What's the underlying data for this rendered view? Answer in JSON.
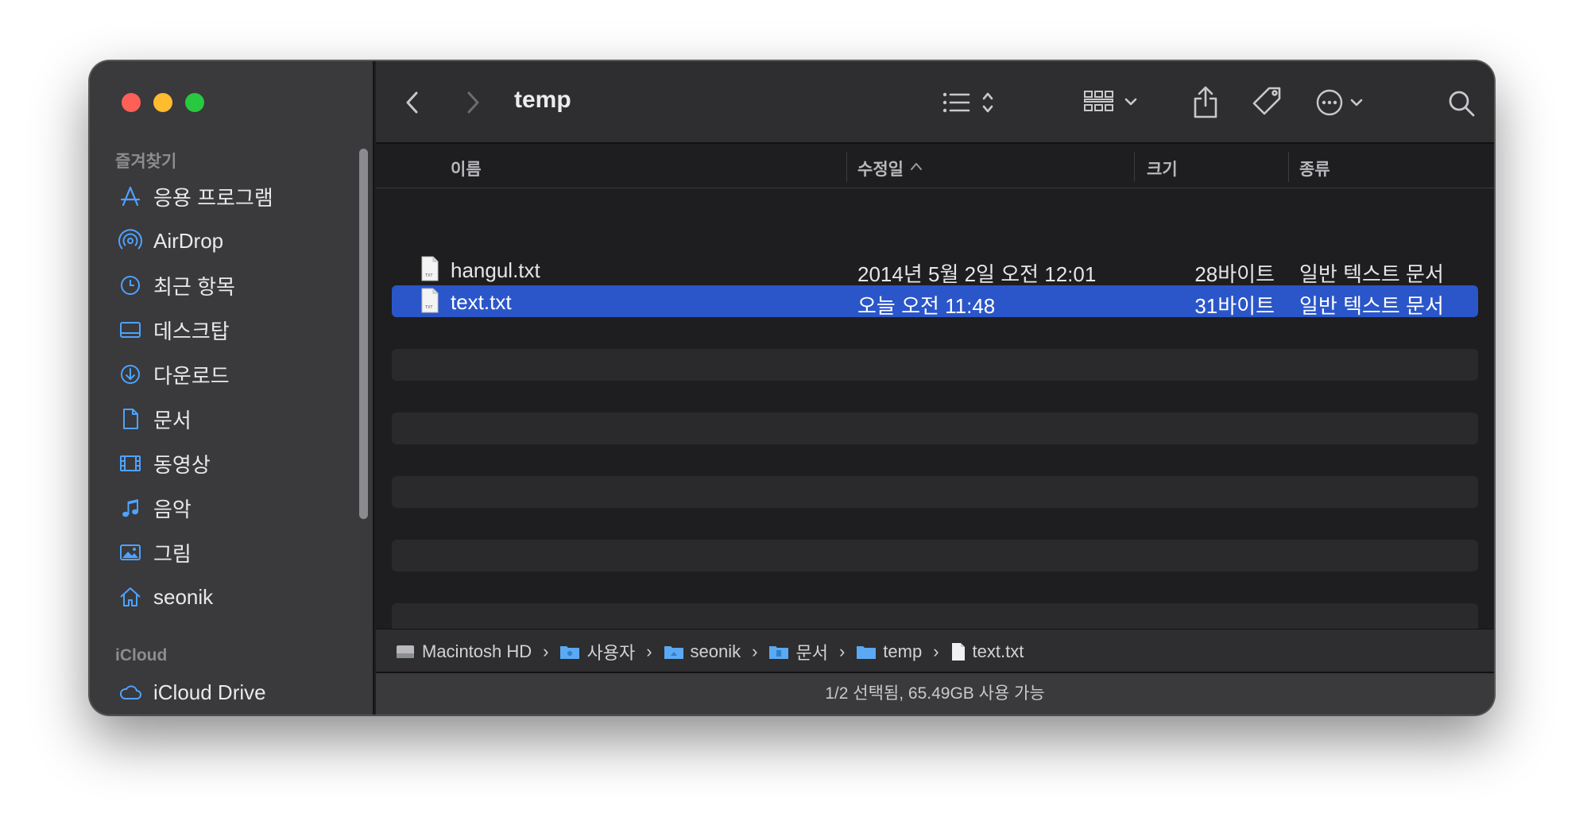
{
  "window": {
    "title": "temp"
  },
  "sidebar": {
    "favorites_label": "즐겨찾기",
    "items": [
      {
        "label": "응용 프로그램",
        "icon": "applications-icon"
      },
      {
        "label": "AirDrop",
        "icon": "airdrop-icon"
      },
      {
        "label": "최근 항목",
        "icon": "recents-clock-icon"
      },
      {
        "label": "데스크탑",
        "icon": "desktop-icon"
      },
      {
        "label": "다운로드",
        "icon": "downloads-icon"
      },
      {
        "label": "문서",
        "icon": "document-icon"
      },
      {
        "label": "동영상",
        "icon": "movies-icon"
      },
      {
        "label": "음악",
        "icon": "music-note-icon"
      },
      {
        "label": "그림",
        "icon": "pictures-icon"
      },
      {
        "label": "seonik",
        "icon": "home-icon"
      }
    ],
    "icloud_label": "iCloud",
    "icloud_items": [
      {
        "label": "iCloud Drive",
        "icon": "cloud-icon"
      }
    ]
  },
  "columns": {
    "name": "이름",
    "modified": "수정일",
    "size": "크기",
    "kind": "종류"
  },
  "files": [
    {
      "name": "hangul.txt",
      "modified": "2014년 5월 2일 오전 12:01",
      "size": "28바이트",
      "kind": "일반 텍스트 문서",
      "selected": false
    },
    {
      "name": "text.txt",
      "modified": "오늘 오전 11:48",
      "size": "31바이트",
      "kind": "일반 텍스트 문서",
      "selected": true
    }
  ],
  "pathbar": [
    {
      "label": "Macintosh HD",
      "icon": "hard-drive-icon"
    },
    {
      "label": "사용자",
      "icon": "folder-icon"
    },
    {
      "label": "seonik",
      "icon": "folder-icon"
    },
    {
      "label": "문서",
      "icon": "folder-icon"
    },
    {
      "label": "temp",
      "icon": "folder-icon"
    },
    {
      "label": "text.txt",
      "icon": "text-file-icon"
    }
  ],
  "status": "1/2 선택됨, 65.49GB 사용 가능",
  "colors": {
    "accent": "#2b56c9",
    "sidebar_icon": "#4da3ff"
  }
}
